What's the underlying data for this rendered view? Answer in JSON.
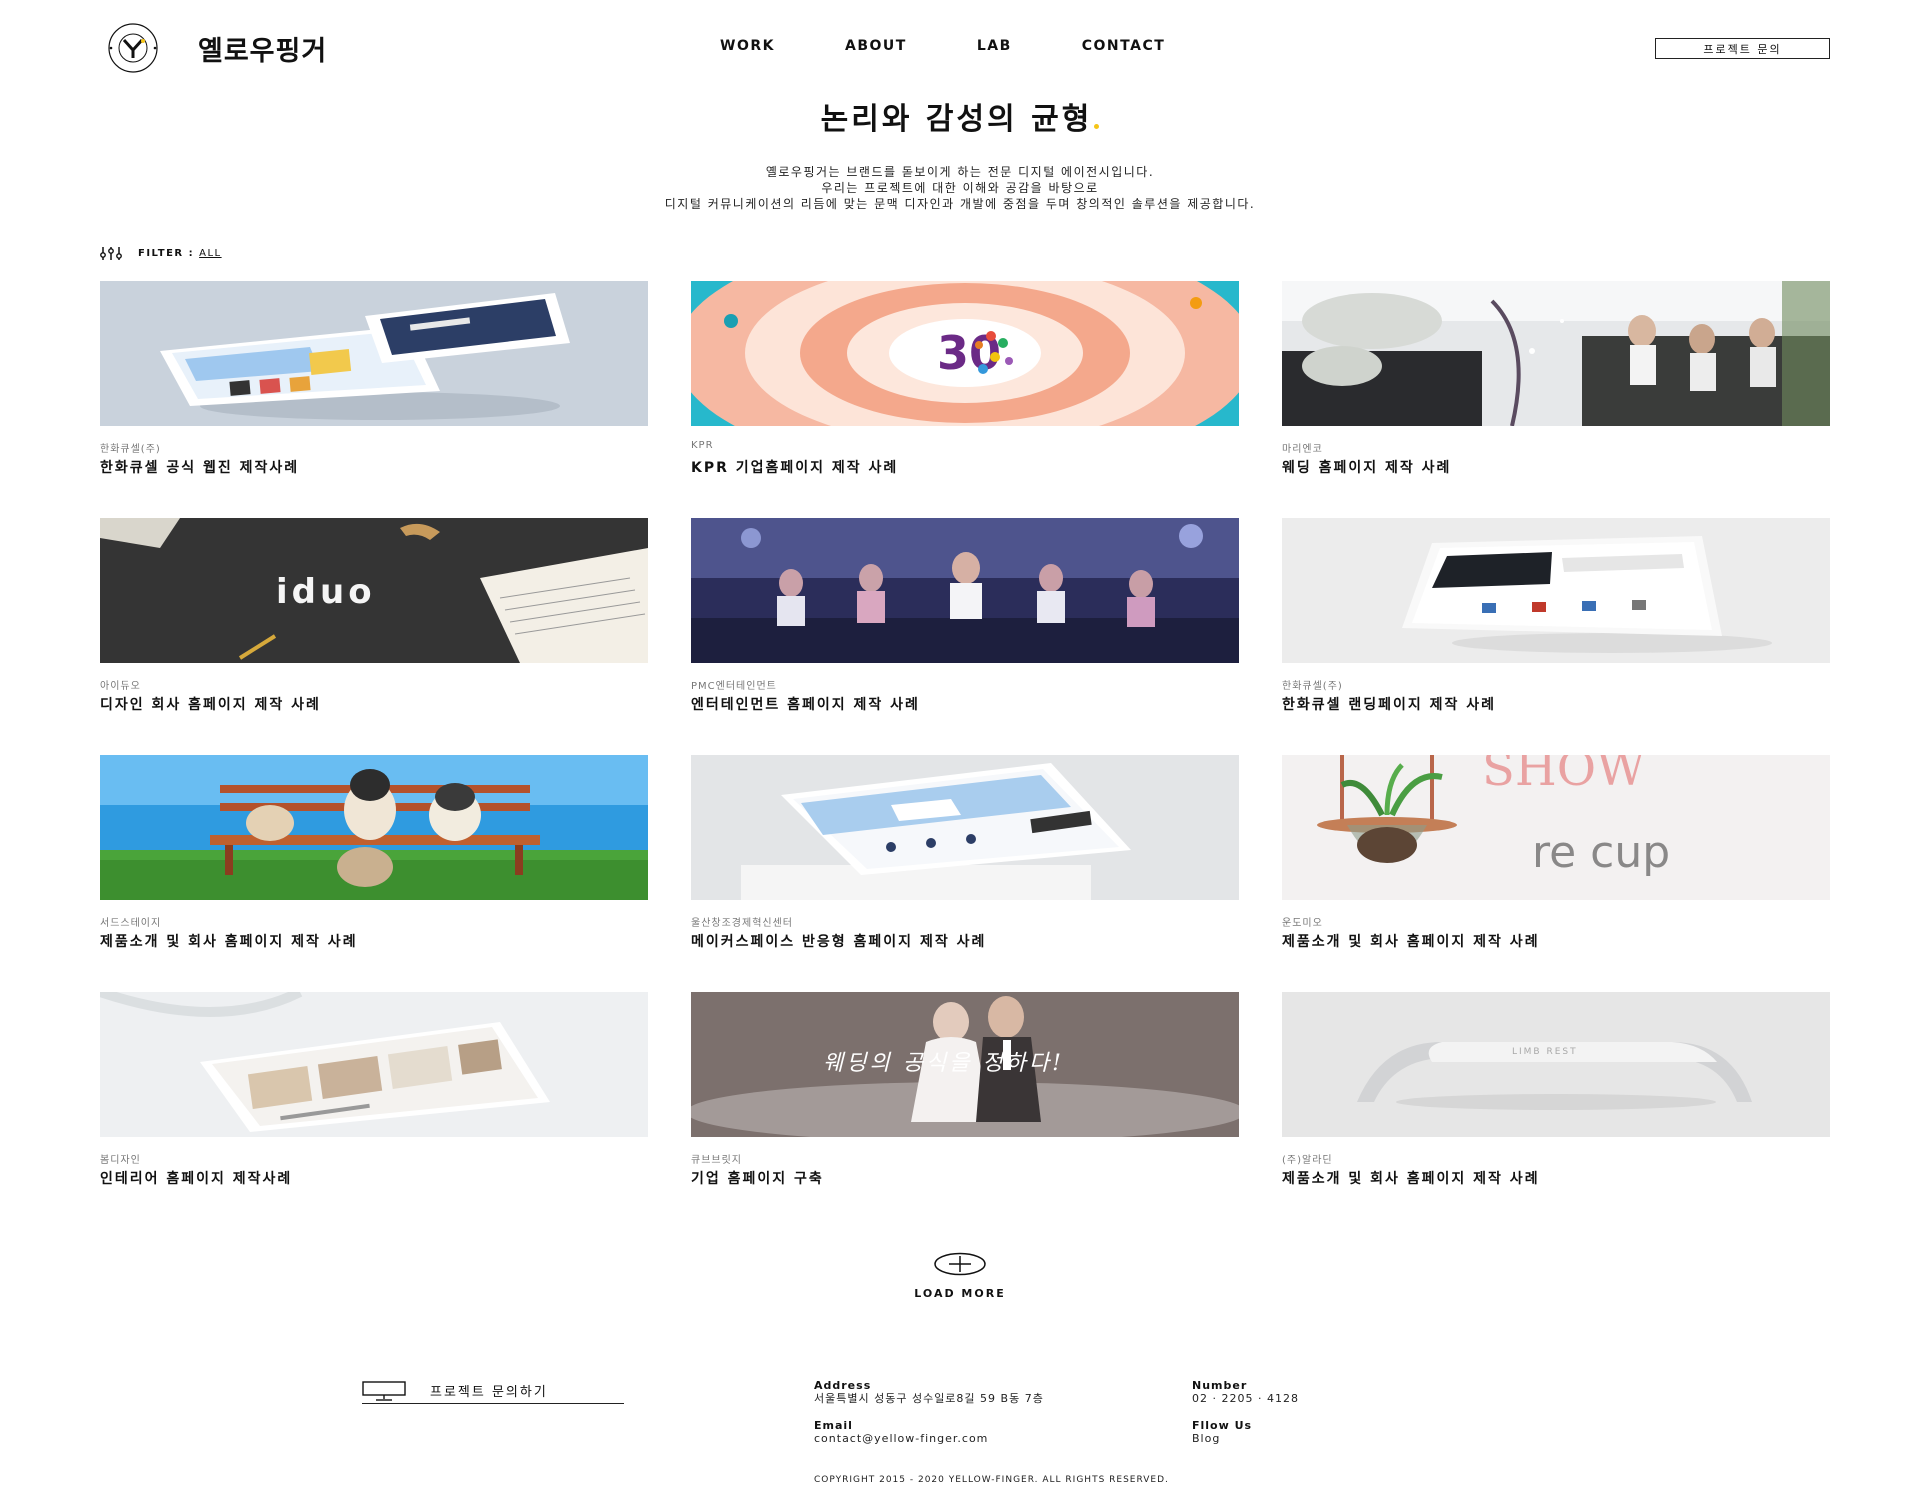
{
  "header": {
    "logo_text": "옐로우핑거",
    "logo_seal_text": "YELLOW FINGER",
    "nav": [
      "WORK",
      "ABOUT",
      "LAB",
      "CONTACT"
    ],
    "inquiry_button": "프로젝트 문의"
  },
  "hero": {
    "title": "논리와 감성의 균형",
    "accent_color": "#f5c518",
    "desc": [
      "옐로우핑거는 브랜드를 돋보이게 하는 전문 디지털 에이전시입니다.",
      "우리는 프로젝트에 대한 이해와 공감을 바탕으로",
      "디지털 커뮤니케이션의 리듬에 맞는 문맥 디자인과 개발에 중점을 두며 창의적인 솔루션을 제공합니다."
    ]
  },
  "filter": {
    "label": "FILTER :",
    "value": "ALL"
  },
  "projects": [
    {
      "client": "한화큐셀(주)",
      "title": "한화큐셀 공식 웹진 제작사례"
    },
    {
      "client": "KPR",
      "title": "KPR 기업홈페이지 제작 사례"
    },
    {
      "client": "마리엔코",
      "title": "웨딩 홈페이지 제작 사례"
    },
    {
      "client": "아이듀오",
      "title": "디자인 회사 홈페이지 제작 사례"
    },
    {
      "client": "PMC엔터테인먼트",
      "title": "엔터테인먼트 홈페이지 제작 사례"
    },
    {
      "client": "한화큐셀(주)",
      "title": "한화큐셀 랜딩페이지 제작 사례"
    },
    {
      "client": "서드스테이지",
      "title": "제품소개 및 회사 홈페이지 제작 사례"
    },
    {
      "client": "울산창조경제혁신센터",
      "title": "메이커스페이스 반응형 홈페이지 제작 사례"
    },
    {
      "client": "운도미오",
      "title": "제품소개 및 회사 홈페이지 제작 사례"
    },
    {
      "client": "봄디자인",
      "title": "인테리어 홈페이지 제작사례"
    },
    {
      "client": "큐브브릿지",
      "title": "기업 홈페이지 구축"
    },
    {
      "client": "(주)알라딘",
      "title": "제품소개 및 회사 홈페이지 제작 사례"
    }
  ],
  "thumb_text": {
    "kpr": "30",
    "iduo": "iduo",
    "wedding_script": "웨딩의 공식을 정하다!",
    "recup_show": "SHOW",
    "recup_brand": "re cup",
    "limb": "LIMB REST"
  },
  "load_more": "LOAD MORE",
  "footer": {
    "cta": "프로젝트 문의하기",
    "address_label": "Address",
    "address": "서울특별시 성동구 성수일로8길 59 B동 7층",
    "number_label": "Number",
    "number": "02 · 2205 · 4128",
    "email_label": "Email",
    "email": "contact@yellow-finger.com",
    "follow_label": "Fllow Us",
    "follow": "Blog",
    "copyright": "COPYRIGHT 2015 - 2020 YELLOW-FINGER. ALL RIGHTS RESERVED."
  }
}
